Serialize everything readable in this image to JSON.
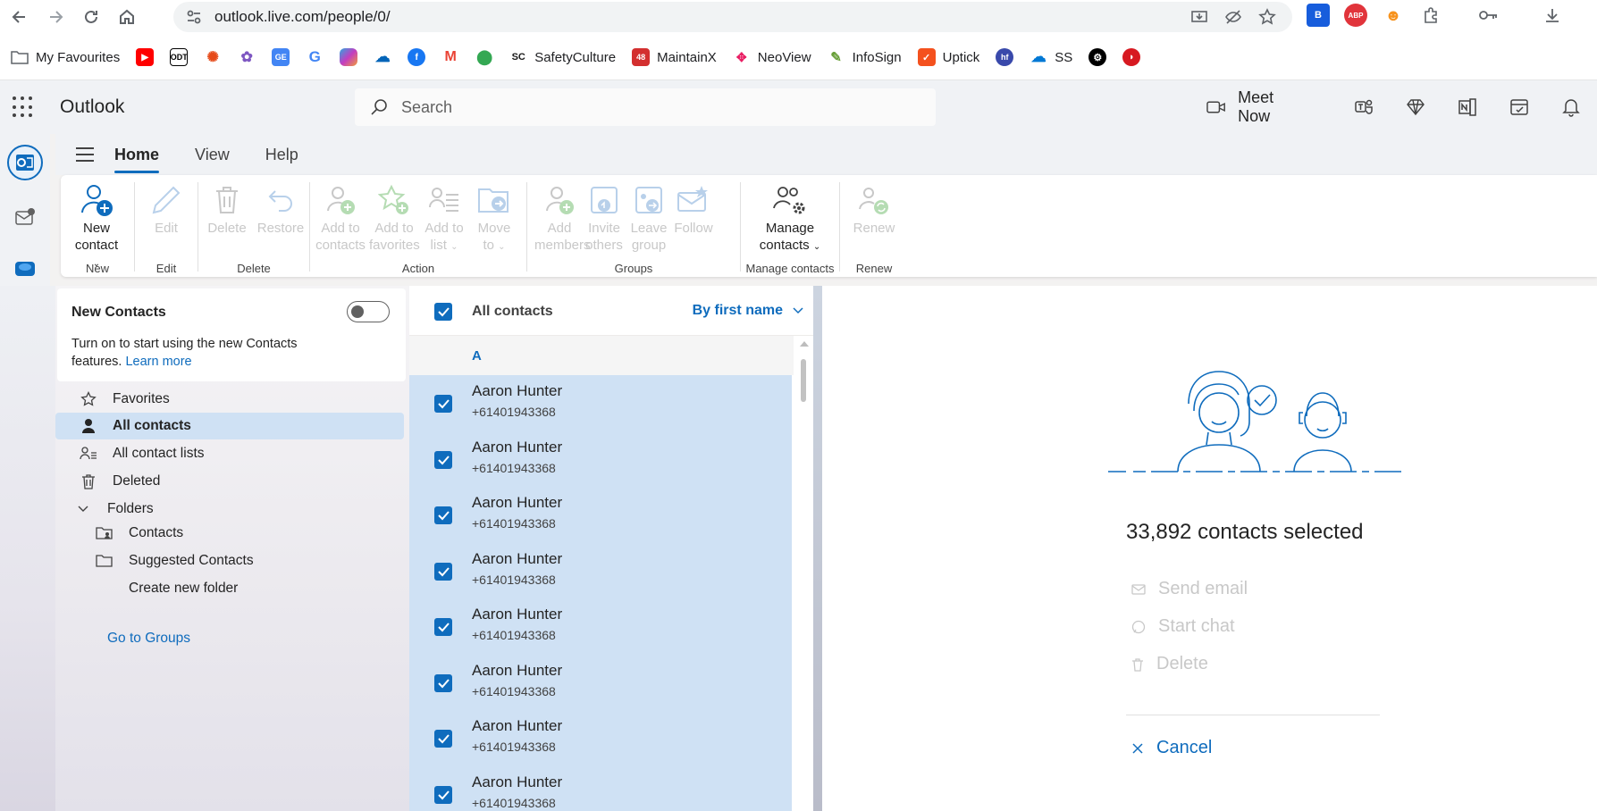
{
  "browser": {
    "url": "outlook.live.com/people/0/",
    "bookmarks": [
      {
        "label": "My Favourites",
        "icon": "folder-icon"
      },
      {
        "label": "",
        "icon": "youtube-icon"
      },
      {
        "label": "",
        "icon": "odt-icon"
      },
      {
        "label": "",
        "icon": "dots-icon"
      },
      {
        "label": "",
        "icon": "butterfly-icon"
      },
      {
        "label": "",
        "icon": "gmeet-icon"
      },
      {
        "label": "",
        "icon": "google-icon"
      },
      {
        "label": "",
        "icon": "copilot-icon"
      },
      {
        "label": "",
        "icon": "onedrive-icon"
      },
      {
        "label": "",
        "icon": "facebook-icon"
      },
      {
        "label": "",
        "icon": "gmail-icon"
      },
      {
        "label": "",
        "icon": "maps-icon"
      },
      {
        "label": "SafetyCulture",
        "icon": "safetyculture-icon"
      },
      {
        "label": "MaintainX",
        "icon": "maintainx-icon"
      },
      {
        "label": "NeoView",
        "icon": "neoview-icon"
      },
      {
        "label": "InfoSign",
        "icon": "infosign-icon"
      },
      {
        "label": "Uptick",
        "icon": "uptick-icon"
      },
      {
        "label": "",
        "icon": "hf-icon"
      },
      {
        "label": "SS",
        "icon": "cloud-icon"
      },
      {
        "label": "",
        "icon": "openai-icon"
      },
      {
        "label": "",
        "icon": "trendmicro-icon"
      }
    ]
  },
  "app": {
    "title": "Outlook",
    "search_placeholder": "Search",
    "meet_now": "Meet Now"
  },
  "tabs": [
    "Home",
    "View",
    "Help"
  ],
  "ribbon": {
    "new_contact_1": "New",
    "new_contact_2": "contact",
    "edit": "Edit",
    "delete": "Delete",
    "restore": "Restore",
    "add_contacts_1": "Add to",
    "add_contacts_2": "contacts",
    "add_favorites_1": "Add to",
    "add_favorites_2": "favorites",
    "add_list_1": "Add to",
    "add_list_2": "list",
    "move_to_1": "Move",
    "move_to_2": "to",
    "add_members_1": "Add",
    "add_members_2": "members",
    "invite_others_1": "Invite",
    "invite_others_2": "others",
    "leave_group_1": "Leave",
    "leave_group_2": "group",
    "follow": "Follow",
    "manage_contacts_1": "Manage",
    "manage_contacts_2": "contacts",
    "renew": "Renew",
    "groups": {
      "new": "New",
      "edit": "Edit",
      "delete": "Delete",
      "action": "Action",
      "groups": "Groups",
      "manage": "Manage contacts",
      "renew": "Renew"
    }
  },
  "nav": {
    "new_contacts_title": "New Contacts",
    "new_contacts_desc": "Turn on to start using the new Contacts features.",
    "learn_more": "Learn more",
    "favorites": "Favorites",
    "all_contacts": "All contacts",
    "all_contact_lists": "All contact lists",
    "deleted": "Deleted",
    "folders": "Folders",
    "contacts": "Contacts",
    "suggested_contacts": "Suggested Contacts",
    "create_new_folder": "Create new folder",
    "go_to_groups": "Go to Groups"
  },
  "list": {
    "header": "All contacts",
    "sort": "By first name",
    "letter": "A",
    "rows": [
      {
        "name": "Aaron Hunter",
        "phone": "+61401943368"
      },
      {
        "name": "Aaron Hunter",
        "phone": "+61401943368"
      },
      {
        "name": "Aaron Hunter",
        "phone": "+61401943368"
      },
      {
        "name": "Aaron Hunter",
        "phone": "+61401943368"
      },
      {
        "name": "Aaron Hunter",
        "phone": "+61401943368"
      },
      {
        "name": "Aaron Hunter",
        "phone": "+61401943368"
      },
      {
        "name": "Aaron Hunter",
        "phone": "+61401943368"
      },
      {
        "name": "Aaron Hunter",
        "phone": "+61401943368"
      }
    ]
  },
  "reading": {
    "selected": "33,892 contacts selected",
    "send_email": "Send email",
    "start_chat": "Start chat",
    "delete": "Delete",
    "cancel": "Cancel"
  },
  "colors": {
    "accent": "#0f6cbd",
    "selection": "#cfe1f4",
    "disabled": "#c8c8c8"
  }
}
